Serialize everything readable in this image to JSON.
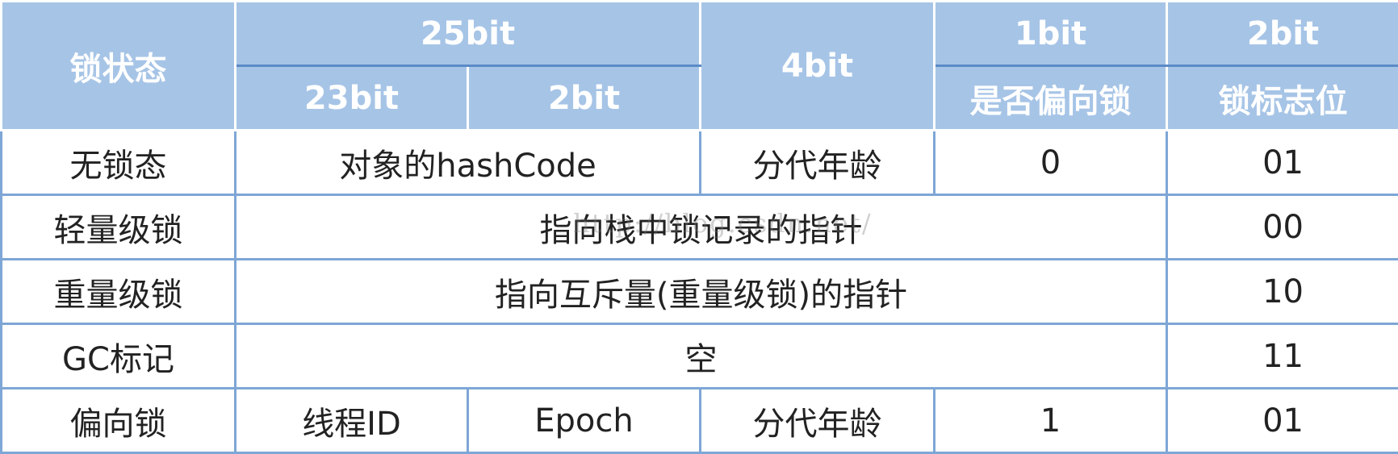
{
  "header": {
    "lock_state": "锁状态",
    "bits_25": "25bit",
    "bits_4": "4bit",
    "bits_1": "1bit",
    "bits_2": "2bit",
    "bits_23": "23bit",
    "bits_2_sub": "2bit",
    "biased_flag": "是否偏向锁",
    "lock_flag": "锁标志位"
  },
  "rows": [
    {
      "state": "无锁态",
      "hash": "对象的hashCode",
      "age": "分代年龄",
      "biased": "0",
      "flag": "01"
    },
    {
      "state": "轻量级锁",
      "content": "指向栈中锁记录的指针",
      "flag": "00"
    },
    {
      "state": "重量级锁",
      "content": "指向互斥量(重量级锁)的指针",
      "flag": "10"
    },
    {
      "state": "GC标记",
      "content": "空",
      "flag": "11"
    },
    {
      "state": "偏向锁",
      "thread_id": "线程ID",
      "epoch": "Epoch",
      "age": "分代年龄",
      "biased": "1",
      "flag": "01"
    }
  ],
  "watermark": "http://blog.csdn.net/",
  "colors": {
    "header_bg": "#a6c4e6",
    "border": "#7ea6d6",
    "header_text": "#ffffff",
    "body_text": "#222222"
  }
}
